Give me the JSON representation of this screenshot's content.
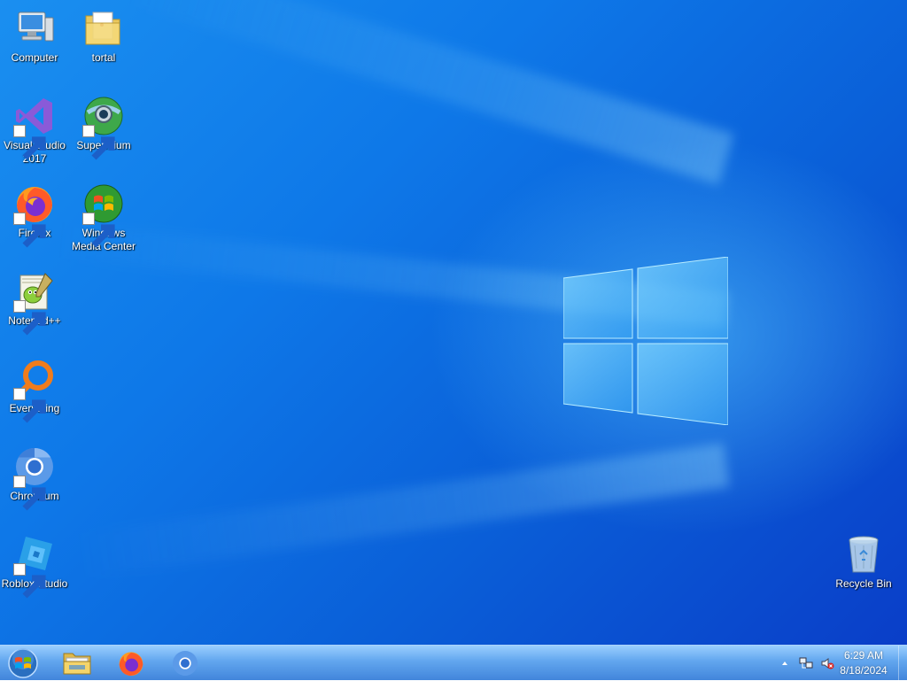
{
  "desktop": {
    "icons": [
      {
        "label": "Computer",
        "icon": "computer-icon",
        "shortcut": false
      },
      {
        "label": "tortal",
        "icon": "folder-icon",
        "shortcut": false
      },
      {
        "label": "Visual Studio 2017",
        "icon": "visual-studio-icon",
        "shortcut": true
      },
      {
        "label": "Supermium",
        "icon": "supermium-icon",
        "shortcut": true
      },
      {
        "label": "Firefox",
        "icon": "firefox-icon",
        "shortcut": true
      },
      {
        "label": "Windows Media Center",
        "icon": "windows-media-center-icon",
        "shortcut": true
      },
      {
        "label": "Notepad++",
        "icon": "notepad-plus-plus-icon",
        "shortcut": true
      },
      {
        "label": "Everything",
        "icon": "everything-search-icon",
        "shortcut": true
      },
      {
        "label": "Chromium",
        "icon": "chromium-icon",
        "shortcut": true
      },
      {
        "label": "Roblox Studio",
        "icon": "roblox-studio-icon",
        "shortcut": true
      },
      {
        "label": "Recycle Bin",
        "icon": "recycle-bin-icon",
        "shortcut": false
      }
    ]
  },
  "taskbar": {
    "pinned": [
      {
        "name": "start-button",
        "icon": "windows-orb-icon"
      },
      {
        "name": "file-explorer",
        "icon": "file-explorer-icon"
      },
      {
        "name": "firefox",
        "icon": "firefox-icon"
      },
      {
        "name": "chromium",
        "icon": "chromium-icon"
      }
    ],
    "tray": {
      "overflow_icon": "chevron-up-icon",
      "network_icon": "network-icon",
      "volume_icon": "volume-muted-icon",
      "time": "6:29 AM",
      "date": "8/18/2024"
    }
  },
  "colors": {
    "wallpaper_primary": "#0e78e8",
    "wallpaper_dark": "#0a3ec8",
    "taskbar": "#4a96e6"
  }
}
